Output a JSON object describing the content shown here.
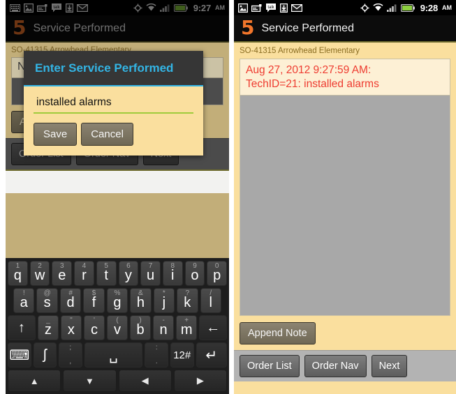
{
  "left": {
    "status": {
      "icons": [
        "keyboard-icon",
        "picture-icon",
        "card-icon",
        "talk-icon",
        "download-icon",
        "mail-icon"
      ],
      "right_icons": [
        "gps-icon",
        "wifi-icon",
        "signal-icon",
        "battery-icon"
      ],
      "time": "9:27",
      "ampm": "AM"
    },
    "title": {
      "logo": "5",
      "label": "Service Performed"
    },
    "subtitle": "SO-41315 Arrowhead Elementary",
    "note_preview": "No",
    "append_label": "Append Note",
    "nav": [
      "Order List",
      "Order Nav",
      "Next"
    ],
    "dialog": {
      "title": "Enter Service Performed",
      "input_value": "installed alarms",
      "input_placeholder": "",
      "save_label": "Save",
      "cancel_label": "Cancel"
    },
    "keyboard": {
      "row1": [
        {
          "alt": "1",
          "main": "q"
        },
        {
          "alt": "2",
          "main": "w"
        },
        {
          "alt": "3",
          "main": "e"
        },
        {
          "alt": "4",
          "main": "r"
        },
        {
          "alt": "5",
          "main": "t"
        },
        {
          "alt": "6",
          "main": "y"
        },
        {
          "alt": "7",
          "main": "u"
        },
        {
          "alt": "8",
          "main": "i"
        },
        {
          "alt": "9",
          "main": "o"
        },
        {
          "alt": "0",
          "main": "p"
        }
      ],
      "row2": [
        {
          "alt": "!",
          "main": "a"
        },
        {
          "alt": "@",
          "main": "s"
        },
        {
          "alt": "#",
          "main": "d"
        },
        {
          "alt": "$",
          "main": "f"
        },
        {
          "alt": "%",
          "main": "g"
        },
        {
          "alt": "&",
          "main": "h"
        },
        {
          "alt": "*",
          "main": "j"
        },
        {
          "alt": "?",
          "main": "k"
        },
        {
          "alt": "/",
          "main": "l"
        }
      ],
      "row3": [
        {
          "alt": "",
          "main": "↑",
          "name": "shift-key"
        },
        {
          "alt": "_",
          "main": "z"
        },
        {
          "alt": "\"",
          "main": "x"
        },
        {
          "alt": "'",
          "main": "c"
        },
        {
          "alt": "(",
          "main": "v"
        },
        {
          "alt": ")",
          "main": "b"
        },
        {
          "alt": "-",
          "main": "n"
        },
        {
          "alt": "+",
          "main": "m"
        },
        {
          "alt": "",
          "main": "←",
          "name": "backspace-key"
        }
      ],
      "row4": [
        {
          "main": "⌨",
          "name": "hide-keyboard-key"
        },
        {
          "main": "ʃ",
          "name": "voice-input-key"
        },
        {
          "alt": ";",
          "alt2": ",",
          "main": "",
          "name": "semicolon-comma-key"
        },
        {
          "main": "␣",
          "name": "space-key"
        },
        {
          "alt": ":",
          "alt2": ".",
          "main": "",
          "name": "colon-period-key"
        },
        {
          "main": "12#",
          "name": "symbols-key"
        },
        {
          "main": "↵",
          "name": "enter-key"
        }
      ],
      "navrow": [
        {
          "main": "▲",
          "name": "nav-up-key"
        },
        {
          "main": "▼",
          "name": "nav-down-key"
        },
        {
          "main": "◀",
          "name": "nav-left-key"
        },
        {
          "main": "▶",
          "name": "nav-right-key"
        }
      ]
    }
  },
  "right": {
    "status": {
      "icons": [
        "picture-icon",
        "card-icon",
        "talk-icon",
        "download-icon",
        "mail-icon"
      ],
      "right_icons": [
        "gps-icon",
        "wifi-icon",
        "signal-icon",
        "battery-icon"
      ],
      "time": "9:28",
      "ampm": "AM"
    },
    "title": {
      "logo": "5",
      "label": "Service Performed"
    },
    "subtitle": "SO-41315 Arrowhead Elementary",
    "note": {
      "line1": "Aug 27, 2012 9:27:59 AM:",
      "line2": "TechID=21: installed alarms"
    },
    "append_label": "Append Note",
    "nav": [
      "Order List",
      "Order Nav",
      "Next"
    ]
  },
  "colors": {
    "accent_blue": "#33b5e5",
    "brand_orange": "#f2762b",
    "note_red": "#ee3b30",
    "page_bg": "#fadf9e",
    "input_underline": "#9fcc3b"
  }
}
